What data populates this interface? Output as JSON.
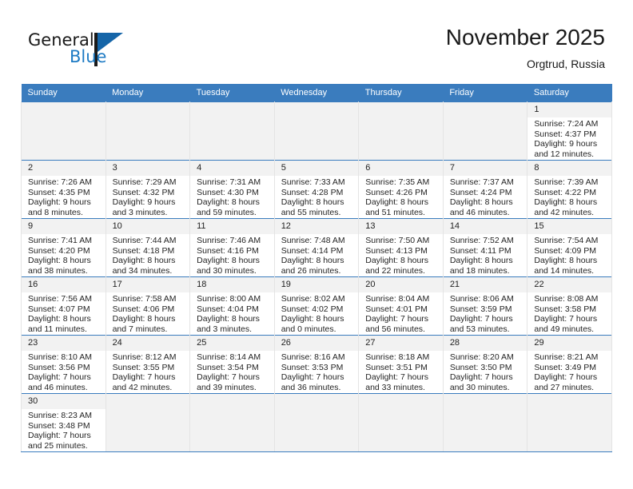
{
  "brand": {
    "name_part1": "General",
    "name_part2": "Blue",
    "flag_icon": "blue-flag-triangle"
  },
  "header": {
    "title": "November 2025",
    "subtitle": "Orgtrud, Russia"
  },
  "calendar": {
    "weekday_headers": [
      "Sunday",
      "Monday",
      "Tuesday",
      "Wednesday",
      "Thursday",
      "Friday",
      "Saturday"
    ],
    "accent_color": "#3a7cbe",
    "daynum_background": "#f2f2f2",
    "weeks": [
      [
        {
          "day": "",
          "empty": true
        },
        {
          "day": "",
          "empty": true
        },
        {
          "day": "",
          "empty": true
        },
        {
          "day": "",
          "empty": true
        },
        {
          "day": "",
          "empty": true
        },
        {
          "day": "",
          "empty": true
        },
        {
          "day": "1",
          "sunrise": "Sunrise: 7:24 AM",
          "sunset": "Sunset: 4:37 PM",
          "daylight_line1": "Daylight: 9 hours",
          "daylight_line2": "and 12 minutes."
        }
      ],
      [
        {
          "day": "2",
          "sunrise": "Sunrise: 7:26 AM",
          "sunset": "Sunset: 4:35 PM",
          "daylight_line1": "Daylight: 9 hours",
          "daylight_line2": "and 8 minutes."
        },
        {
          "day": "3",
          "sunrise": "Sunrise: 7:29 AM",
          "sunset": "Sunset: 4:32 PM",
          "daylight_line1": "Daylight: 9 hours",
          "daylight_line2": "and 3 minutes."
        },
        {
          "day": "4",
          "sunrise": "Sunrise: 7:31 AM",
          "sunset": "Sunset: 4:30 PM",
          "daylight_line1": "Daylight: 8 hours",
          "daylight_line2": "and 59 minutes."
        },
        {
          "day": "5",
          "sunrise": "Sunrise: 7:33 AM",
          "sunset": "Sunset: 4:28 PM",
          "daylight_line1": "Daylight: 8 hours",
          "daylight_line2": "and 55 minutes."
        },
        {
          "day": "6",
          "sunrise": "Sunrise: 7:35 AM",
          "sunset": "Sunset: 4:26 PM",
          "daylight_line1": "Daylight: 8 hours",
          "daylight_line2": "and 51 minutes."
        },
        {
          "day": "7",
          "sunrise": "Sunrise: 7:37 AM",
          "sunset": "Sunset: 4:24 PM",
          "daylight_line1": "Daylight: 8 hours",
          "daylight_line2": "and 46 minutes."
        },
        {
          "day": "8",
          "sunrise": "Sunrise: 7:39 AM",
          "sunset": "Sunset: 4:22 PM",
          "daylight_line1": "Daylight: 8 hours",
          "daylight_line2": "and 42 minutes."
        }
      ],
      [
        {
          "day": "9",
          "sunrise": "Sunrise: 7:41 AM",
          "sunset": "Sunset: 4:20 PM",
          "daylight_line1": "Daylight: 8 hours",
          "daylight_line2": "and 38 minutes."
        },
        {
          "day": "10",
          "sunrise": "Sunrise: 7:44 AM",
          "sunset": "Sunset: 4:18 PM",
          "daylight_line1": "Daylight: 8 hours",
          "daylight_line2": "and 34 minutes."
        },
        {
          "day": "11",
          "sunrise": "Sunrise: 7:46 AM",
          "sunset": "Sunset: 4:16 PM",
          "daylight_line1": "Daylight: 8 hours",
          "daylight_line2": "and 30 minutes."
        },
        {
          "day": "12",
          "sunrise": "Sunrise: 7:48 AM",
          "sunset": "Sunset: 4:14 PM",
          "daylight_line1": "Daylight: 8 hours",
          "daylight_line2": "and 26 minutes."
        },
        {
          "day": "13",
          "sunrise": "Sunrise: 7:50 AM",
          "sunset": "Sunset: 4:13 PM",
          "daylight_line1": "Daylight: 8 hours",
          "daylight_line2": "and 22 minutes."
        },
        {
          "day": "14",
          "sunrise": "Sunrise: 7:52 AM",
          "sunset": "Sunset: 4:11 PM",
          "daylight_line1": "Daylight: 8 hours",
          "daylight_line2": "and 18 minutes."
        },
        {
          "day": "15",
          "sunrise": "Sunrise: 7:54 AM",
          "sunset": "Sunset: 4:09 PM",
          "daylight_line1": "Daylight: 8 hours",
          "daylight_line2": "and 14 minutes."
        }
      ],
      [
        {
          "day": "16",
          "sunrise": "Sunrise: 7:56 AM",
          "sunset": "Sunset: 4:07 PM",
          "daylight_line1": "Daylight: 8 hours",
          "daylight_line2": "and 11 minutes."
        },
        {
          "day": "17",
          "sunrise": "Sunrise: 7:58 AM",
          "sunset": "Sunset: 4:06 PM",
          "daylight_line1": "Daylight: 8 hours",
          "daylight_line2": "and 7 minutes."
        },
        {
          "day": "18",
          "sunrise": "Sunrise: 8:00 AM",
          "sunset": "Sunset: 4:04 PM",
          "daylight_line1": "Daylight: 8 hours",
          "daylight_line2": "and 3 minutes."
        },
        {
          "day": "19",
          "sunrise": "Sunrise: 8:02 AM",
          "sunset": "Sunset: 4:02 PM",
          "daylight_line1": "Daylight: 8 hours",
          "daylight_line2": "and 0 minutes."
        },
        {
          "day": "20",
          "sunrise": "Sunrise: 8:04 AM",
          "sunset": "Sunset: 4:01 PM",
          "daylight_line1": "Daylight: 7 hours",
          "daylight_line2": "and 56 minutes."
        },
        {
          "day": "21",
          "sunrise": "Sunrise: 8:06 AM",
          "sunset": "Sunset: 3:59 PM",
          "daylight_line1": "Daylight: 7 hours",
          "daylight_line2": "and 53 minutes."
        },
        {
          "day": "22",
          "sunrise": "Sunrise: 8:08 AM",
          "sunset": "Sunset: 3:58 PM",
          "daylight_line1": "Daylight: 7 hours",
          "daylight_line2": "and 49 minutes."
        }
      ],
      [
        {
          "day": "23",
          "sunrise": "Sunrise: 8:10 AM",
          "sunset": "Sunset: 3:56 PM",
          "daylight_line1": "Daylight: 7 hours",
          "daylight_line2": "and 46 minutes."
        },
        {
          "day": "24",
          "sunrise": "Sunrise: 8:12 AM",
          "sunset": "Sunset: 3:55 PM",
          "daylight_line1": "Daylight: 7 hours",
          "daylight_line2": "and 42 minutes."
        },
        {
          "day": "25",
          "sunrise": "Sunrise: 8:14 AM",
          "sunset": "Sunset: 3:54 PM",
          "daylight_line1": "Daylight: 7 hours",
          "daylight_line2": "and 39 minutes."
        },
        {
          "day": "26",
          "sunrise": "Sunrise: 8:16 AM",
          "sunset": "Sunset: 3:53 PM",
          "daylight_line1": "Daylight: 7 hours",
          "daylight_line2": "and 36 minutes."
        },
        {
          "day": "27",
          "sunrise": "Sunrise: 8:18 AM",
          "sunset": "Sunset: 3:51 PM",
          "daylight_line1": "Daylight: 7 hours",
          "daylight_line2": "and 33 minutes."
        },
        {
          "day": "28",
          "sunrise": "Sunrise: 8:20 AM",
          "sunset": "Sunset: 3:50 PM",
          "daylight_line1": "Daylight: 7 hours",
          "daylight_line2": "and 30 minutes."
        },
        {
          "day": "29",
          "sunrise": "Sunrise: 8:21 AM",
          "sunset": "Sunset: 3:49 PM",
          "daylight_line1": "Daylight: 7 hours",
          "daylight_line2": "and 27 minutes."
        }
      ],
      [
        {
          "day": "30",
          "sunrise": "Sunrise: 8:23 AM",
          "sunset": "Sunset: 3:48 PM",
          "daylight_line1": "Daylight: 7 hours",
          "daylight_line2": "and 25 minutes."
        },
        {
          "day": "",
          "empty": true
        },
        {
          "day": "",
          "empty": true
        },
        {
          "day": "",
          "empty": true
        },
        {
          "day": "",
          "empty": true
        },
        {
          "day": "",
          "empty": true
        },
        {
          "day": "",
          "empty": true
        }
      ]
    ]
  }
}
